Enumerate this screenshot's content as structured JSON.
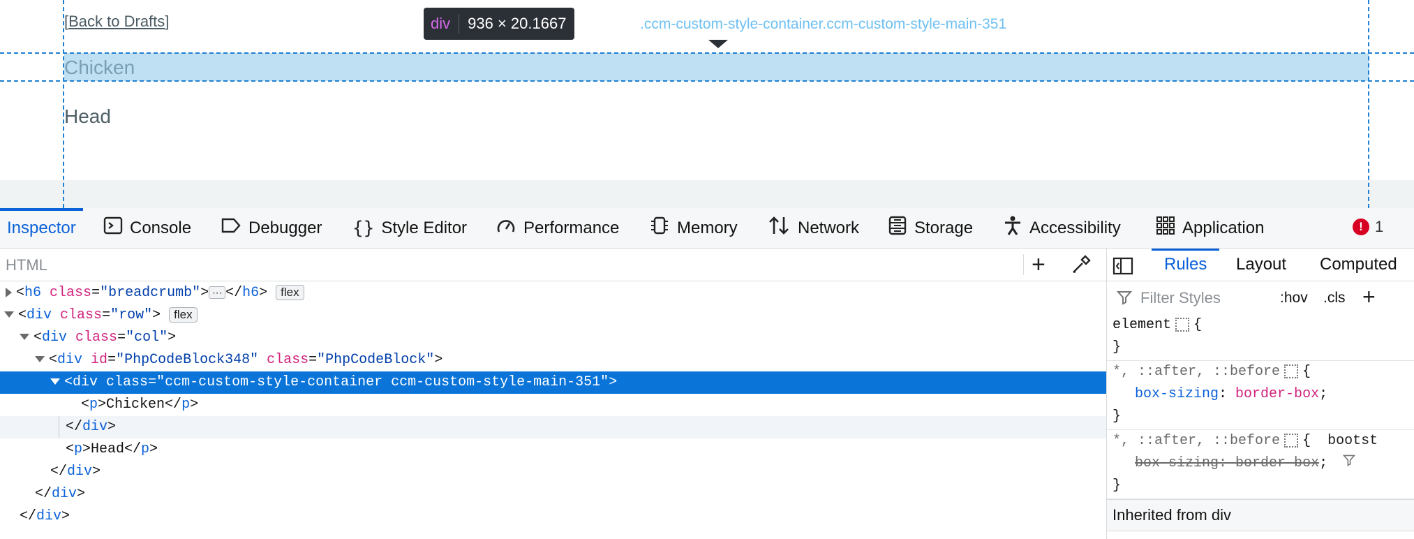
{
  "page": {
    "back_link": "Back to Drafts",
    "highlighted_text": "Chicken",
    "below_text": "Head"
  },
  "tooltip": {
    "tag": "div",
    "classes": ".ccm-custom-style-container.ccm-custom-style-main-351",
    "dimensions": "936 × 20.1667"
  },
  "tabs": [
    {
      "label": "Inspector",
      "icon": "inspector-icon"
    },
    {
      "label": "Console",
      "icon": "console-icon"
    },
    {
      "label": "Debugger",
      "icon": "debugger-icon"
    },
    {
      "label": "Style Editor",
      "icon": "style-editor-icon"
    },
    {
      "label": "Performance",
      "icon": "performance-icon"
    },
    {
      "label": "Memory",
      "icon": "memory-icon"
    },
    {
      "label": "Network",
      "icon": "network-icon"
    },
    {
      "label": "Storage",
      "icon": "storage-icon"
    },
    {
      "label": "Accessibility",
      "icon": "accessibility-icon"
    },
    {
      "label": "Application",
      "icon": "application-icon"
    }
  ],
  "error_count": "1",
  "markup": {
    "search_placeholder": "HTML",
    "badge_flex": "flex",
    "ellipsis": "⋯"
  },
  "rules_panel": {
    "tabs": [
      "Rules",
      "Layout",
      "Computed"
    ],
    "filter_placeholder": "Filter Styles",
    "hov": ":hov",
    "cls": ".cls",
    "element_selector": "element",
    "rule2_selector": "*, ::after, ::before",
    "rule2_prop": "box-sizing",
    "rule2_val": "border-box",
    "rule3_source": "bootst",
    "inherited_label": "Inherited from div"
  },
  "colors": {
    "accent": "#0a61d8",
    "selection": "#0a74d9",
    "highlight": "#bfe0f2",
    "error": "#d70022"
  }
}
